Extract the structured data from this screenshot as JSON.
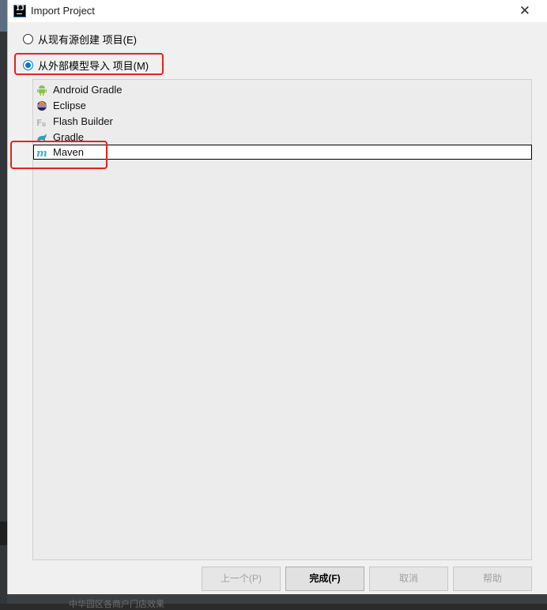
{
  "window": {
    "title": "Import Project",
    "app_icon_text": "IJ"
  },
  "options": [
    {
      "label": "从现有源创建 项目(E)",
      "selected": false
    },
    {
      "label": "从外部模型导入 项目(M)",
      "selected": true
    }
  ],
  "models": [
    {
      "label": "Android Gradle",
      "icon": "android-icon",
      "selected": false
    },
    {
      "label": "Eclipse",
      "icon": "eclipse-icon",
      "selected": false
    },
    {
      "label": "Flash Builder",
      "icon": "flash-builder-icon",
      "selected": false
    },
    {
      "label": "Gradle",
      "icon": "gradle-icon",
      "selected": false
    },
    {
      "label": "Maven",
      "icon": "maven-icon",
      "selected": true
    }
  ],
  "buttons": {
    "previous": "上一个(P)",
    "finish": "完成(F)",
    "cancel": "取消",
    "help": "帮助"
  },
  "background_hint": "中华园区各商户门店效果",
  "colors": {
    "highlight": "#e8231c",
    "radio_accent": "#0078d7"
  }
}
